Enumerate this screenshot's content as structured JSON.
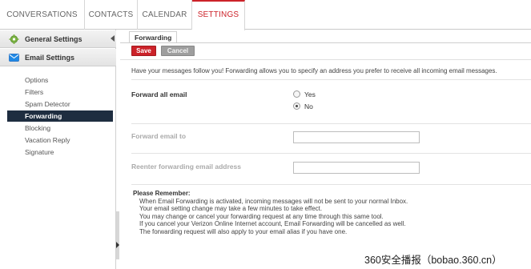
{
  "topnav": {
    "tabs": [
      {
        "label": "CONVERSATIONS"
      },
      {
        "label": "CONTACTS"
      },
      {
        "label": "CALENDAR"
      },
      {
        "label": "SETTINGS"
      }
    ]
  },
  "sidebar": {
    "general_settings": "General Settings",
    "email_settings": "Email Settings",
    "items": [
      "Options",
      "Filters",
      "Spam Detector",
      "Forwarding",
      "Blocking",
      "Vacation Reply",
      "Signature"
    ],
    "active_item": "Forwarding"
  },
  "content": {
    "tab_label": "Forwarding",
    "save_label": "Save",
    "cancel_label": "Cancel",
    "intro": "Have your messages follow you! Forwarding allows you to specify an address you prefer to receive all incoming email messages.",
    "forward_all_label": "Forward all email",
    "option_yes": "Yes",
    "option_no": "No",
    "selected_option": "No",
    "forward_to_label": "Forward email to",
    "forward_to_value": "",
    "reenter_label": "Reenter forwarding email address",
    "reenter_value": "",
    "remember_title": "Please Remember:",
    "remember_lines": [
      "When Email Forwarding is activated, incoming messages will not be sent to your normal Inbox.",
      "Your email setting change may take a few minutes to take effect.",
      "You may change or cancel your forwarding request at any time through this same tool.",
      "If you cancel your Verizon Online Internet account, Email Forwarding will be cancelled as well.",
      "The forwarding request will also apply to your email alias if you have one."
    ]
  },
  "watermark": "360安全播报（bobao.360.cn）",
  "colors": {
    "accent": "#cc2229",
    "active_sidebar": "#1e2d40",
    "cancel_button": "#9e9e9e"
  }
}
